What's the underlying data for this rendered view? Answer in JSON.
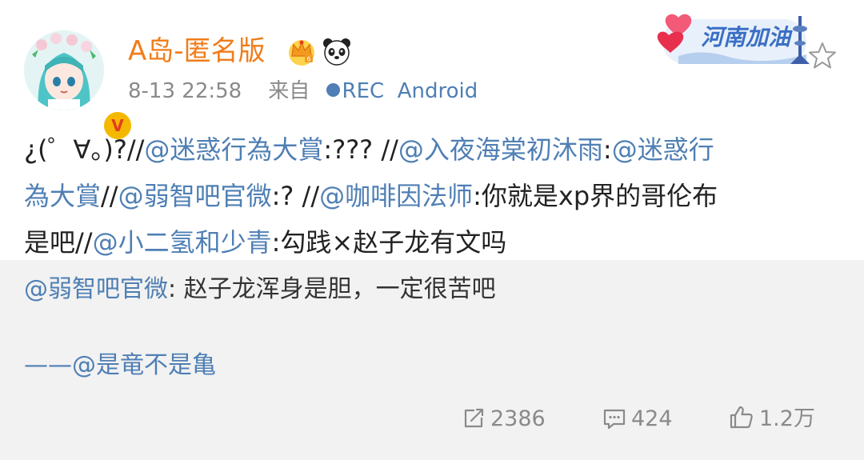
{
  "post": {
    "username": "A岛-匿名版",
    "timestamp": "8-13 22:58",
    "source_prefix": "来自",
    "source_app": "REC  Android",
    "badge_text": "河南加油",
    "content": {
      "line1": [
        {
          "text": "¿(゜∀。)?//",
          "mention": false
        },
        {
          "text": "@迷惑行為大賞",
          "mention": true
        },
        {
          "text": ":???  //",
          "mention": false
        },
        {
          "text": "@入夜海棠初沐雨",
          "mention": true
        },
        {
          "text": ":",
          "mention": false
        },
        {
          "text": "@迷惑行",
          "mention": true
        }
      ],
      "line2": [
        {
          "text": "為大賞",
          "mention": true
        },
        {
          "text": "//",
          "mention": false
        },
        {
          "text": "@弱智吧官微",
          "mention": true
        },
        {
          "text": ":?  //",
          "mention": false
        },
        {
          "text": "@咖啡因法师",
          "mention": true
        },
        {
          "text": ":你就是xp界的哥伦布",
          "mention": false
        }
      ],
      "line3": [
        {
          "text": "是吧//",
          "mention": false
        },
        {
          "text": "@小二氢和少青",
          "mention": true
        },
        {
          "text": ":勾践×赵子龙有文吗",
          "mention": false
        }
      ]
    }
  },
  "quote": {
    "mention": "@弱智吧官微",
    "text": ": 赵子龙浑身是胆，一定很苦吧",
    "signature": "——@是竜不是亀"
  },
  "actions": {
    "repost_count": "2386",
    "comment_count": "424",
    "like_count": "1.2万"
  },
  "colors": {
    "username": "#f07d1a",
    "link": "#4f7fb4",
    "quote_bg": "#f2f2f2",
    "meta_gray": "#8a8a8a"
  },
  "icons": [
    "vip-crown-icon",
    "panda-icon",
    "star-icon",
    "repost-icon",
    "comment-icon",
    "like-icon",
    "verified-badge-icon"
  ]
}
